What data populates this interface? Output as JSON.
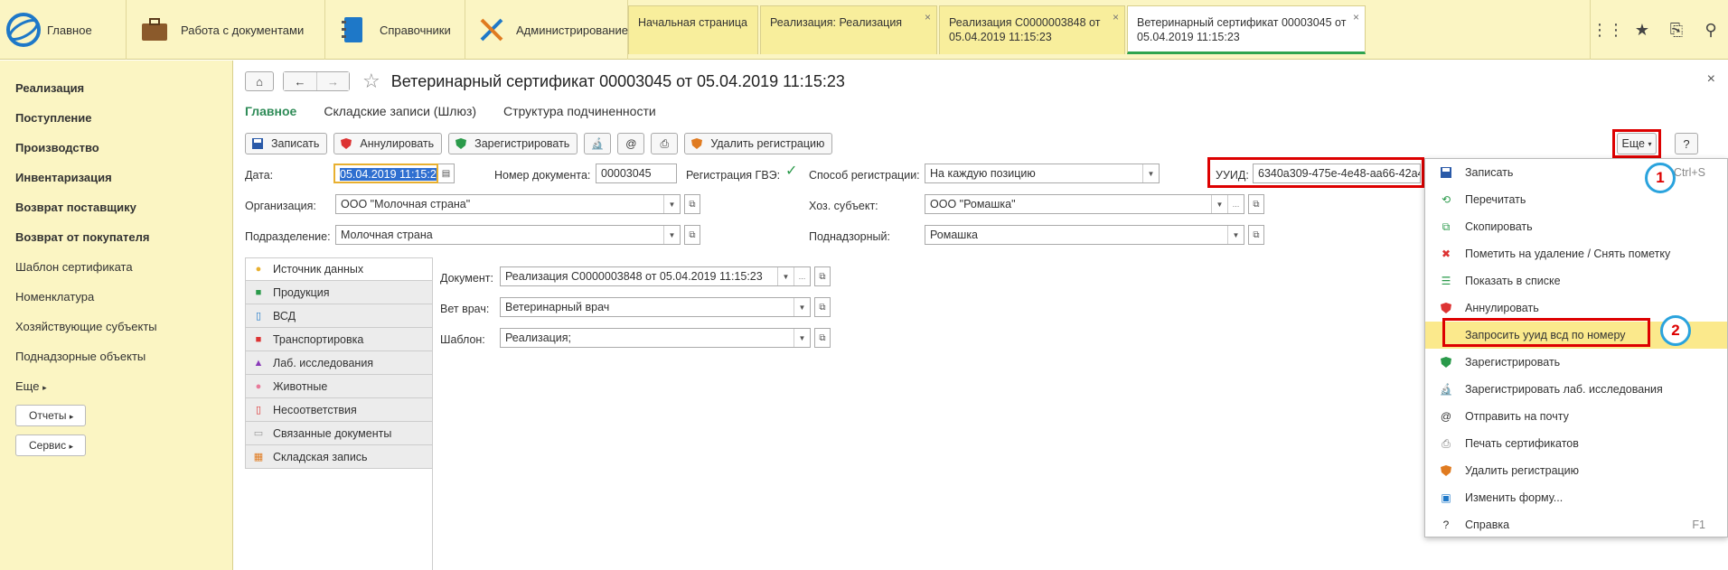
{
  "top": {
    "home_label": "Главное",
    "sections": [
      {
        "label": "Работа с документами"
      },
      {
        "label": "Справочники"
      },
      {
        "label": "Администрирование"
      }
    ],
    "tabs": [
      {
        "label": "Начальная страница"
      },
      {
        "label": "Реализация: Реализация"
      },
      {
        "label": "Реализация С0000003848 от 05.04.2019 11:15:23"
      },
      {
        "label": "Ветеринарный сертификат 00003045 от 05.04.2019 11:15:23"
      }
    ]
  },
  "sidebar": {
    "items": [
      {
        "label": "Реализация"
      },
      {
        "label": "Поступление"
      },
      {
        "label": "Производство"
      },
      {
        "label": "Инвентаризация"
      },
      {
        "label": "Возврат поставщику"
      },
      {
        "label": "Возврат от покупателя"
      },
      {
        "label": "Шаблон сертификата"
      },
      {
        "label": "Номенклатура"
      },
      {
        "label": "Хозяйствующие субъекты"
      },
      {
        "label": "Поднадзорные объекты"
      }
    ],
    "more": "Еще",
    "reports": "Отчеты",
    "service": "Сервис"
  },
  "doc": {
    "title": "Ветеринарный сертификат 00003045 от 05.04.2019 11:15:23",
    "subtabs": [
      "Главное",
      "Складские записи (Шлюз)",
      "Структура подчиненности"
    ],
    "toolbar": {
      "save": "Записать",
      "cancel": "Аннулировать",
      "register": "Зарегистрировать",
      "delete_reg": "Удалить регистрацию",
      "more": "Еще",
      "help": "?"
    },
    "fields": {
      "date_label": "Дата:",
      "date_value": "05.04.2019 11:15:23",
      "num_label": "Номер документа:",
      "num_value": "00003045",
      "gvz_label": "Регистрация ГВЭ:",
      "method_label": "Способ регистрации:",
      "method_value": "На каждую позицию",
      "uuid_label": "УУИД:",
      "uuid_value": "6340a309-475e-4e48-aa66-42a4",
      "org_label": "Организация:",
      "org_value": "ООО \"Молочная страна\"",
      "subject_label": "Хоз. субъект:",
      "subject_value": "ООО \"Ромашка\"",
      "dept_label": "Подразделение:",
      "dept_value": "Молочная страна",
      "supervised_label": "Поднадзорный:",
      "supervised_value": "Ромашка",
      "document_label": "Документ:",
      "document_value": "Реализация С0000003848 от 05.04.2019 11:15:23",
      "vet_label": "Вет врач:",
      "vet_value": "Ветеринарный врач",
      "template_label": "Шаблон:",
      "template_value": "Реализация;"
    },
    "side_tabs": [
      {
        "label": "Источник данных"
      },
      {
        "label": "Продукция"
      },
      {
        "label": "ВСД"
      },
      {
        "label": "Транспортировка"
      },
      {
        "label": "Лаб. исследования"
      },
      {
        "label": "Животные"
      },
      {
        "label": "Несоответствия"
      },
      {
        "label": "Связанные документы"
      },
      {
        "label": "Складская запись"
      }
    ]
  },
  "menu": {
    "items": [
      {
        "label": "Записать",
        "shortcut": "Ctrl+S"
      },
      {
        "label": "Перечитать",
        "shortcut": ""
      },
      {
        "label": "Скопировать",
        "shortcut": ""
      },
      {
        "label": "Пометить на удаление / Снять пометку",
        "shortcut": ""
      },
      {
        "label": "Показать в списке",
        "shortcut": ""
      },
      {
        "label": "Аннулировать",
        "shortcut": ""
      },
      {
        "label": "Запросить ууид всд по номеру",
        "shortcut": ""
      },
      {
        "label": "Зарегистрировать",
        "shortcut": ""
      },
      {
        "label": "Зарегистрировать лаб. исследования",
        "shortcut": ""
      },
      {
        "label": "Отправить на почту",
        "shortcut": ""
      },
      {
        "label": "Печать сертификатов",
        "shortcut": ""
      },
      {
        "label": "Удалить регистрацию",
        "shortcut": ""
      },
      {
        "label": "Изменить форму...",
        "shortcut": ""
      },
      {
        "label": "Справка",
        "shortcut": "F1"
      }
    ]
  },
  "badges": [
    "1",
    "2"
  ],
  "colors": {
    "accent_green": "#2e8b57",
    "highlight_red": "#dd0000",
    "badge_blue": "#2aa3dd",
    "panel_yellow": "#fbf5c3"
  }
}
